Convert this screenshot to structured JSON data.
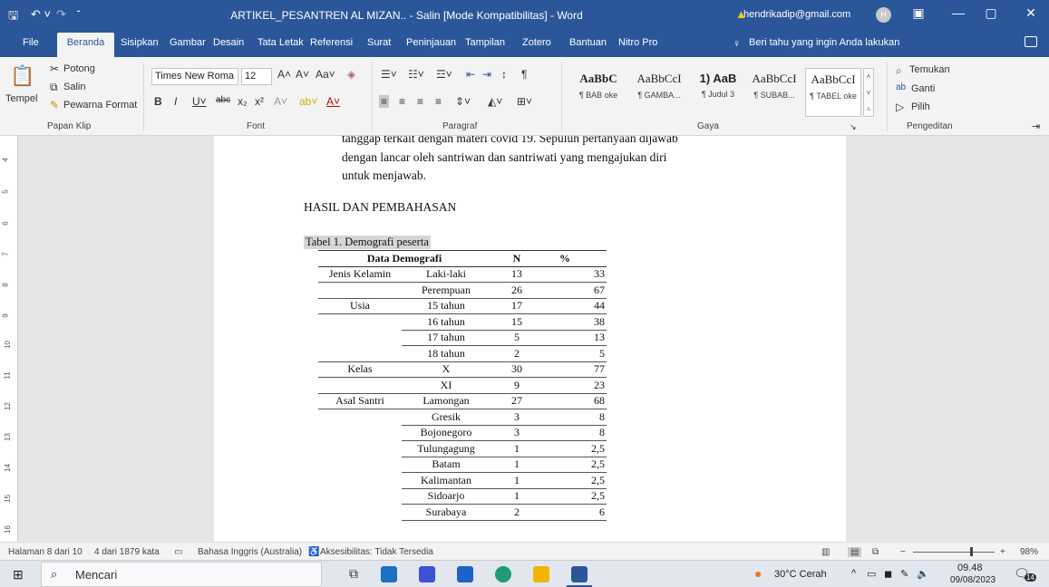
{
  "titlebar": {
    "doc_title": "ARTIKEL_PESANTREN AL MIZAN.. - Salin [Mode Kompatibilitas] - Word",
    "account": "hendrikadip@gmail.com",
    "avatar": "H"
  },
  "tabs": [
    "File",
    "Beranda",
    "Sisipkan",
    "Gambar",
    "Desain",
    "Tata Letak",
    "Referensi",
    "Surat",
    "Peninjauan",
    "Tampilan",
    "Zotero",
    "Bantuan",
    "Nitro Pro"
  ],
  "tellme": "Beri tahu yang ingin Anda lakukan",
  "ribbon": {
    "clipboard": {
      "paste": "Tempel",
      "cut": "Potong",
      "copy": "Salin",
      "painter": "Pewarna Format",
      "label": "Papan Klip"
    },
    "font": {
      "name": "Times New Roma",
      "size": "12",
      "label": "Font"
    },
    "paragraph": {
      "label": "Paragraf"
    },
    "styles": {
      "label": "Gaya",
      "items": [
        {
          "preview": "AaBbC",
          "name": "¶ BAB oke"
        },
        {
          "preview": "AaBbCcI",
          "name": "¶ GAMBA..."
        },
        {
          "preview": "1) AaB",
          "name": "¶ Judul 3"
        },
        {
          "preview": "AaBbCcI",
          "name": "¶ SUBAB..."
        },
        {
          "preview": "AaBbCcI",
          "name": "¶ TABEL oke"
        }
      ]
    },
    "editing": {
      "find": "Temukan",
      "replace": "Ganti",
      "select": "Pilih",
      "label": "Pengeditan"
    }
  },
  "document": {
    "para_lines": [
      "tanggap terkait dengan materi covid 19. Sepuluh pertanyaan dijawab",
      "dengan lancar oleh santriwan dan santriwati yang mengajukan diri",
      "untuk menjawab."
    ],
    "heading": "HASIL DAN PEMBAHASAN",
    "table_caption": "Tabel 1. Demografi peserta",
    "table": {
      "headers": [
        "Data Demografi",
        "N",
        "%"
      ],
      "rows": [
        [
          "Jenis Kelamin",
          "Laki-laki",
          "13",
          "33"
        ],
        [
          "",
          "Perempuan",
          "26",
          "67"
        ],
        [
          "Usia",
          "15 tahun",
          "17",
          "44"
        ],
        [
          "",
          "16 tahun",
          "15",
          "38"
        ],
        [
          "",
          "17 tahun",
          "5",
          "13"
        ],
        [
          "",
          "18 tahun",
          "2",
          "5"
        ],
        [
          "Kelas",
          "X",
          "30",
          "77"
        ],
        [
          "",
          "XI",
          "9",
          "23"
        ],
        [
          "Asal Santri",
          "Lamongan",
          "27",
          "68"
        ],
        [
          "",
          "Gresik",
          "3",
          "8"
        ],
        [
          "",
          "Bojonegoro",
          "3",
          "8"
        ],
        [
          "",
          "Tulungagung",
          "1",
          "2,5"
        ],
        [
          "",
          "Batam",
          "1",
          "2,5"
        ],
        [
          "",
          "Kalimantan",
          "1",
          "2,5"
        ],
        [
          "",
          "Sidoarjo",
          "1",
          "2,5"
        ],
        [
          "",
          "Surabaya",
          "2",
          "6"
        ]
      ]
    }
  },
  "ruler_numbers": [
    "4",
    "5",
    "6",
    "7",
    "8",
    "9",
    "10",
    "11",
    "12",
    "13",
    "14",
    "15",
    "16"
  ],
  "status": {
    "page": "Halaman 8 dari 10",
    "words": "4 dari 1879 kata",
    "language": "Bahasa Inggris (Australia)",
    "accessibility": "Aksesibilitas: Tidak Tersedia",
    "zoom": "98%"
  },
  "taskbar": {
    "search": "Mencari",
    "weather": "30°C  Cerah",
    "time": "09.48",
    "date": "09/08/2023",
    "notifications": "14"
  }
}
